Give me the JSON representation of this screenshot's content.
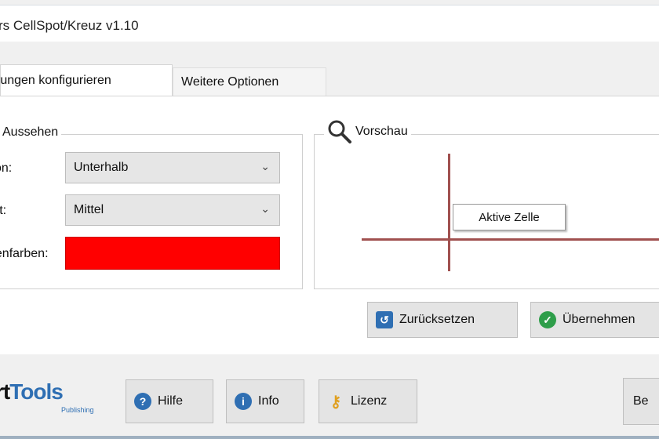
{
  "window": {
    "title": "rs CellSpot/Kreuz v1.10"
  },
  "tabs": [
    {
      "label": "rungen konfigurieren"
    },
    {
      "label": "Weitere Optionen"
    }
  ],
  "appearance": {
    "title": "Aussehen",
    "position_label": "tion:",
    "position_value": "Unterhalb",
    "style_label": "art:",
    "style_value": "Mittel",
    "color_label": "benfarben:",
    "color": "#ff0000"
  },
  "preview": {
    "title": "Vorschau",
    "cell_label": "Aktive Zelle",
    "line_color": "#a0504f"
  },
  "actions": {
    "reset_label": "Zurücksetzen",
    "apply_label": "Übernehmen"
  },
  "footer": {
    "logo_text_1": "rt",
    "logo_text_2": "Tools",
    "logo_sub": "Publishing",
    "help_label": "Hilfe",
    "info_label": "Info",
    "license_label": "Lizenz",
    "close_label": "Be"
  },
  "icons": [
    "search-icon",
    "reset-icon",
    "check-icon",
    "help-icon",
    "info-icon",
    "key-icon",
    "chevron-down-icon"
  ]
}
